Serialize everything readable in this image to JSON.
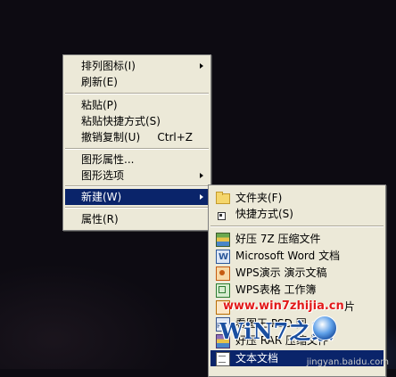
{
  "context_menu": {
    "items": [
      {
        "label": "排列图标(I)",
        "submenu": true
      },
      {
        "label": "刷新(E)"
      },
      {
        "label": "粘贴(P)"
      },
      {
        "label": "粘贴快捷方式(S)"
      },
      {
        "label": "撤销复制(U)",
        "shortcut": "Ctrl+Z"
      },
      {
        "label": "图形属性..."
      },
      {
        "label": "图形选项",
        "submenu": true
      },
      {
        "label": "新建(W)",
        "submenu": true,
        "highlighted": true
      },
      {
        "label": "属性(R)"
      }
    ]
  },
  "new_submenu": {
    "items": [
      {
        "label": "文件夹(F)",
        "icon": "folder-icon"
      },
      {
        "label": "快捷方式(S)",
        "icon": "shortcut-icon"
      },
      {
        "label": "好压 7Z 压缩文件",
        "icon": "zip-archive-icon"
      },
      {
        "label": "Microsoft Word 文档",
        "icon": "word-document-icon"
      },
      {
        "label": "WPS演示 演示文稿",
        "icon": "wps-presentation-icon"
      },
      {
        "label": "WPS表格 工作簿",
        "icon": "wps-spreadsheet-icon"
      },
      {
        "label": "片",
        "icon": "image-file-icon"
      },
      {
        "label": "看图王 PSD 图",
        "icon": "psd-file-icon"
      },
      {
        "label": "好压 RAR 压缩文件",
        "icon": "rar-archive-icon"
      },
      {
        "label": "文本文档",
        "icon": "text-document-icon",
        "highlighted": true
      }
    ]
  },
  "watermark": {
    "site": "www.win7zhijia.cn",
    "logo": "WiN7之家",
    "baidu": "jingyan.baidu.com"
  },
  "colors": {
    "menu_bg": "#ece9d8",
    "highlight": "#0a246a",
    "desktop": "#0d0b12"
  }
}
